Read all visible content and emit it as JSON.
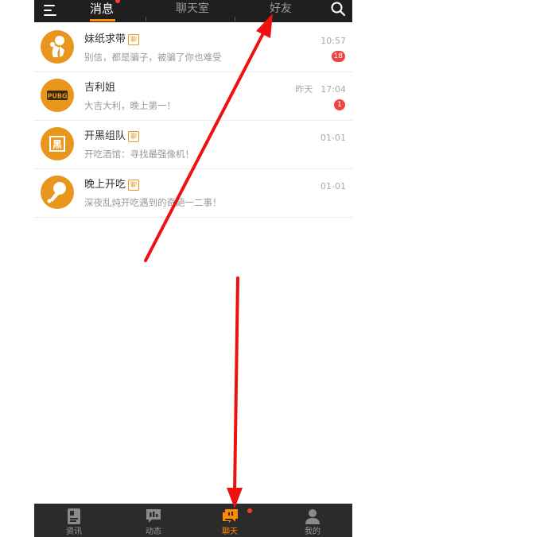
{
  "header": {
    "tabs": [
      {
        "label": "消息",
        "active": true
      },
      {
        "label": "聊天室",
        "active": false
      },
      {
        "label": "好友",
        "active": false
      }
    ]
  },
  "conversations": [
    {
      "name": "妹纸求带",
      "tag": "聊",
      "preview": "别信，都是骗子，被骗了你也难受",
      "time": "10:57",
      "day": "",
      "unread": "18"
    },
    {
      "name": "吉利姐",
      "tag": "",
      "preview": "大吉大利，晚上第一！",
      "time": "17:04",
      "day": "昨天",
      "unread": "1"
    },
    {
      "name": "开黑组队",
      "tag": "聊",
      "preview": "开吃酒馆：寻找最强像机！",
      "time": "01-01",
      "day": "",
      "unread": ""
    },
    {
      "name": "晚上开吃",
      "tag": "聊",
      "preview": "深夜乱炖开吃遇到的奇葩一二事！",
      "time": "01-01",
      "day": "",
      "unread": ""
    }
  ],
  "avatar_texts": {
    "pubg": "PUBG",
    "hei": "黑"
  },
  "bottom_nav": [
    {
      "label": "资讯",
      "icon": "news-icon",
      "active": false
    },
    {
      "label": "动态",
      "icon": "feed-icon",
      "active": false
    },
    {
      "label": "聊天",
      "icon": "chat-icon",
      "active": true
    },
    {
      "label": "我的",
      "icon": "profile-icon",
      "active": false
    }
  ],
  "colors": {
    "accent": "#ff8a00",
    "badge": "#f04444",
    "avatar": "#e8961c",
    "annotation_arrow": "#ee1111"
  }
}
